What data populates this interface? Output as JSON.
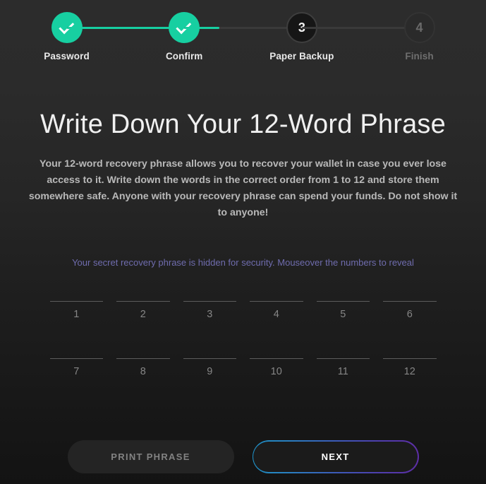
{
  "stepper": {
    "steps": [
      {
        "label": "Password",
        "state": "done",
        "marker": "check-icon"
      },
      {
        "label": "Confirm",
        "state": "done",
        "marker": "check-icon"
      },
      {
        "label": "Paper Backup",
        "state": "current",
        "marker": "3"
      },
      {
        "label": "Finish",
        "state": "pending",
        "marker": "4"
      }
    ],
    "connectors": [
      {
        "fill_percent": 100
      },
      {
        "fill_percent": 30
      },
      {
        "fill_percent": 0
      }
    ]
  },
  "main": {
    "title": "Write Down Your 12-Word Phrase",
    "description": "Your 12-word recovery phrase allows you to recover your wallet in case you ever lose access to it. Write down the words in the correct order from 1 to 12 and store them somewhere safe. Anyone with your recovery phrase can spend your funds. Do not show it to anyone!",
    "hint": "Your secret recovery phrase is hidden for security. Mouseover the numbers to reveal"
  },
  "phrase": {
    "slots": [
      {
        "index": "1",
        "word": ""
      },
      {
        "index": "2",
        "word": ""
      },
      {
        "index": "3",
        "word": ""
      },
      {
        "index": "4",
        "word": ""
      },
      {
        "index": "5",
        "word": ""
      },
      {
        "index": "6",
        "word": ""
      },
      {
        "index": "7",
        "word": ""
      },
      {
        "index": "8",
        "word": ""
      },
      {
        "index": "9",
        "word": ""
      },
      {
        "index": "10",
        "word": ""
      },
      {
        "index": "11",
        "word": ""
      },
      {
        "index": "12",
        "word": ""
      }
    ]
  },
  "footer": {
    "print_label": "PRINT PHRASE",
    "next_label": "NEXT"
  },
  "colors": {
    "accent_teal": "#17cfa1",
    "hint_purple": "#6f6cae",
    "gradient_start": "#1f8fc4",
    "gradient_end": "#5d2ea6",
    "background_top": "#2c2c2c",
    "background_bottom": "#131313"
  }
}
